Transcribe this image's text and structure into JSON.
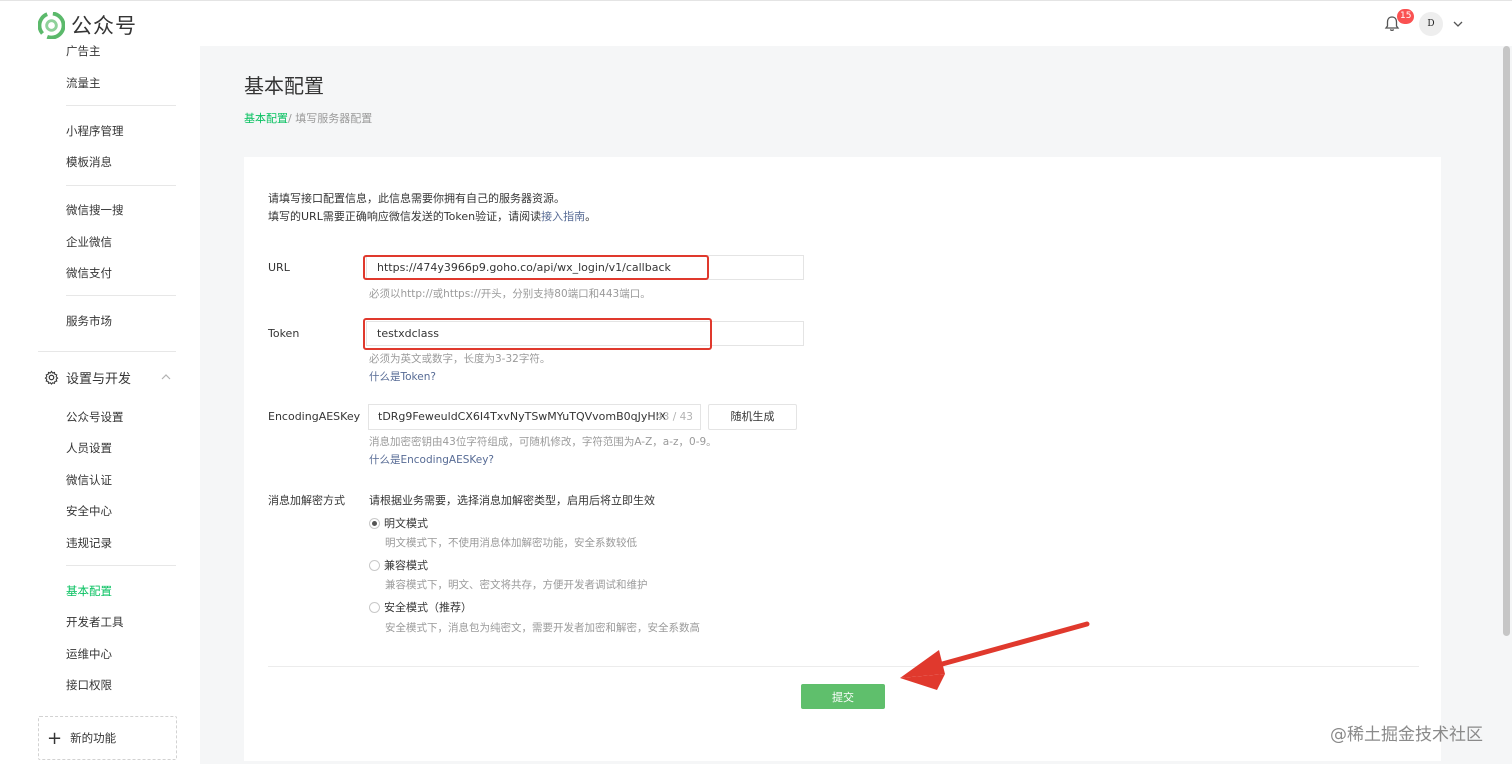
{
  "header": {
    "logo_text": "公众号",
    "notification_count": "15",
    "avatar_text": "D"
  },
  "sidebar": {
    "items_top": [
      "广告主",
      "流量主"
    ],
    "items_mini": [
      "小程序管理",
      "模板消息"
    ],
    "items_search": [
      "微信搜一搜",
      "企业微信",
      "微信支付"
    ],
    "items_market": [
      "服务市场"
    ],
    "group_title": "设置与开发",
    "group_items": [
      "公众号设置",
      "人员设置",
      "微信认证",
      "安全中心",
      "违规记录"
    ],
    "dev_items": [
      "基本配置",
      "开发者工具",
      "运维中心",
      "接口权限"
    ],
    "active_item": "基本配置",
    "new_function": "新的功能"
  },
  "page": {
    "title": "基本配置",
    "breadcrumb_link": "基本配置",
    "breadcrumb_current": "/ 填写服务器配置"
  },
  "form": {
    "intro_line1": "请填写接口配置信息，此信息需要你拥有自己的服务器资源。",
    "intro_line2_prefix": "填写的URL需要正确响应微信发送的Token验证，请阅读",
    "intro_link": "接入指南",
    "intro_line2_suffix": "。",
    "url_label": "URL",
    "url_value": "https://474y3966p9.goho.co/api/wx_login/v1/callback",
    "url_hint": "必须以http://或https://开头，分别支持80端口和443端口。",
    "token_label": "Token",
    "token_value": "testxdclass",
    "token_hint": "必须为英文或数字，长度为3-32字符。",
    "token_link": "什么是Token?",
    "aes_label": "EncodingAESKey",
    "aes_value": "tDRg9FeweuldCX6I4TxvNyTSwMYuTQVvomB0qJyHIX",
    "aes_counter": "43 / 43",
    "aes_button": "随机生成",
    "aes_hint": "消息加密密钥由43位字符组成，可随机修改，字符范围为A-Z，a-z，0-9。",
    "aes_link": "什么是EncodingAESKey?",
    "mode_label": "消息加解密方式",
    "mode_desc": "请根据业务需要，选择消息加解密类型，启用后将立即生效",
    "modes": [
      {
        "label": "明文模式",
        "desc": "明文模式下，不使用消息体加解密功能，安全系数较低",
        "checked": true
      },
      {
        "label": "兼容模式",
        "desc": "兼容模式下，明文、密文将共存，方便开发者调试和维护",
        "checked": false
      },
      {
        "label": "安全模式（推荐）",
        "desc": "安全模式下，消息包为纯密文，需要开发者加密和解密，安全系数高",
        "checked": false
      }
    ],
    "submit_label": "提交"
  },
  "watermark": "@稀土掘金技术社区",
  "colors": {
    "accent": "#07c160",
    "submit": "#5fbf6c",
    "highlight": "#e0392d",
    "link": "#576b95"
  }
}
